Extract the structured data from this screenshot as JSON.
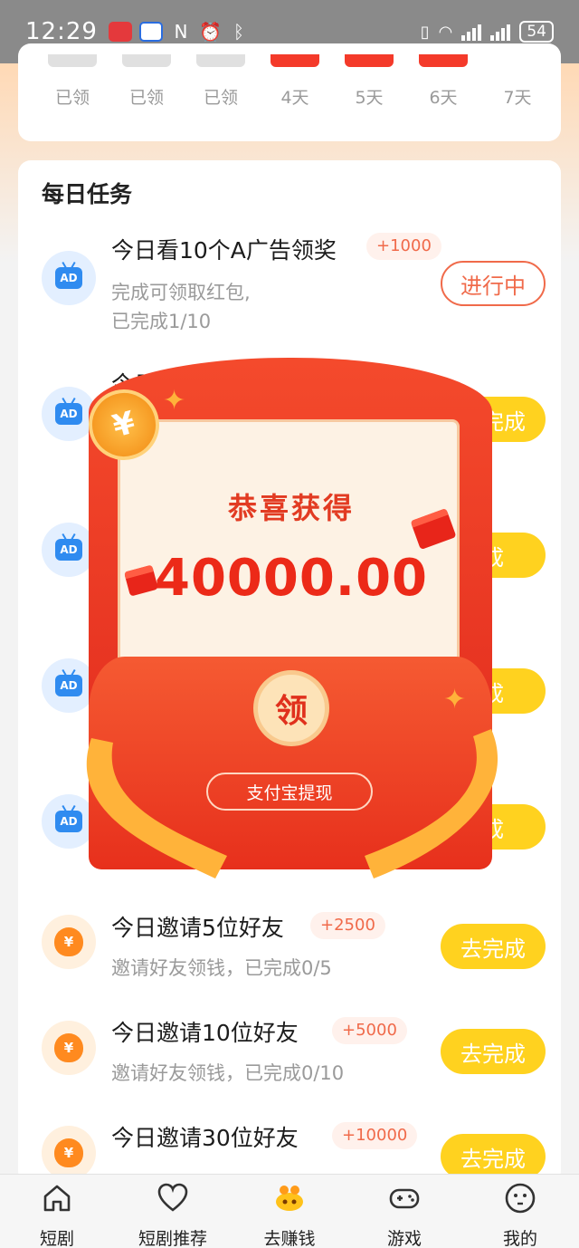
{
  "status_bar": {
    "time": "12:29",
    "battery": "54"
  },
  "signin": {
    "days": [
      {
        "label": "已领",
        "claimed": true
      },
      {
        "label": "已领",
        "claimed": true
      },
      {
        "label": "已领",
        "claimed": true
      },
      {
        "label": "4天",
        "claimed": false
      },
      {
        "label": "5天",
        "claimed": false
      },
      {
        "label": "6天",
        "claimed": false
      },
      {
        "label": "7天",
        "claimed": false
      }
    ]
  },
  "tasks": {
    "title": "每日任务",
    "items": [
      {
        "icon": "ad-icon",
        "title": "今日看10个A广告领奖",
        "reward": "+1000",
        "desc1": "完成可领取红包,",
        "desc2": "已完成1/10",
        "button": "进行中"
      },
      {
        "icon": "ad-icon",
        "title": "今日看",
        "reward": "",
        "desc1": "",
        "desc2": "",
        "button": "去完成"
      },
      {
        "icon": "ad-icon",
        "title": "",
        "reward": "",
        "desc1": "",
        "desc2": "",
        "button": "成"
      },
      {
        "icon": "ad-icon",
        "title": "",
        "reward": "",
        "desc1": "",
        "desc2": "",
        "button": "成"
      },
      {
        "icon": "ad-icon",
        "title": "",
        "reward": "",
        "desc1": "",
        "desc2": "",
        "button": "成"
      },
      {
        "icon": "money-bag-icon",
        "title": "今日邀请5位好友",
        "reward": "+2500",
        "desc1": "邀请好友领钱，已完成0/5",
        "desc2": "",
        "button": "去完成"
      },
      {
        "icon": "money-bag-icon",
        "title": "今日邀请10位好友",
        "reward": "+5000",
        "desc1": "邀请好友领钱，已完成0/10",
        "desc2": "",
        "button": "去完成"
      },
      {
        "icon": "money-bag-icon",
        "title": "今日邀请30位好友",
        "reward": "+10000",
        "desc1": "",
        "desc2": "",
        "button": "去完成"
      }
    ]
  },
  "popup": {
    "congrats": "恭喜获得",
    "amount": "40000.00",
    "claim": "领",
    "withdraw": "支付宝提现"
  },
  "bottom_nav": [
    {
      "label": "短剧",
      "icon": "home-icon",
      "active": false
    },
    {
      "label": "短剧推荐",
      "icon": "heart-icon",
      "active": false
    },
    {
      "label": "去赚钱",
      "icon": "treasure-icon",
      "active": true
    },
    {
      "label": "游戏",
      "icon": "gamepad-icon",
      "active": false
    },
    {
      "label": "我的",
      "icon": "smiley-icon",
      "active": false
    }
  ],
  "colors": {
    "accent": "#f06a4a",
    "button_yellow": "#ffd21f",
    "envelope_red": "#e7301c"
  }
}
